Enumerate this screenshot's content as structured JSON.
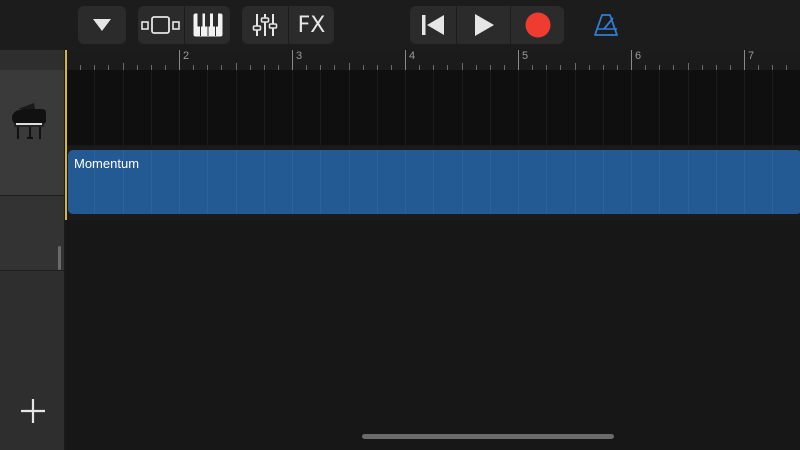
{
  "toolbar": {
    "icons": [
      "caret-down-icon",
      "tracks-view-icon",
      "piano-keyboard-icon",
      "mixer-icon",
      "rewind-to-start-icon",
      "play-icon",
      "record-icon",
      "metronome-icon"
    ],
    "fx_label": "FX",
    "record_color": "#ef3b30",
    "metronome_color": "#2f7ed8"
  },
  "ruler": {
    "bars": [
      "2",
      "3",
      "4",
      "5",
      "6",
      "7"
    ]
  },
  "tracks": [
    {
      "instrument_icon": "grand-piano-icon",
      "regions": []
    },
    {
      "regions": [
        {
          "name": "Momentum",
          "color": "#245a94"
        }
      ]
    }
  ],
  "sidebar": {
    "add_icon": "plus-icon"
  }
}
